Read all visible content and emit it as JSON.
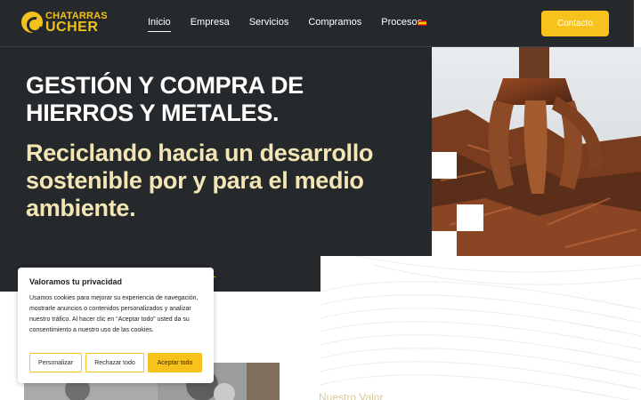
{
  "brand": {
    "line1": "CHATARRAS",
    "line2": "UCHER",
    "color": "#f2c11b"
  },
  "nav": {
    "items": [
      {
        "label": "Inicio",
        "active": true
      },
      {
        "label": "Empresa"
      },
      {
        "label": "Servicios"
      },
      {
        "label": "Compramos"
      },
      {
        "label": "Procesos"
      }
    ],
    "language_flag": "es-flag-icon",
    "contact_label": "Contacto"
  },
  "hero": {
    "title": "GESTIÓN Y COMPRA DE HIERROS Y METALES.",
    "subtitle": "Reciclando hacia un desarrollo sostenible por y para el medio ambiente.",
    "image": "scrap-metal-grapple-image"
  },
  "section": {
    "label": "Nuestro Valor",
    "image": "scrap-metal-pile-image"
  },
  "cookie": {
    "title": "Valoramos tu privacidad",
    "text": "Usamos cookies para mejorar su experiencia de navegación, mostrarle anuncios o contenidos personalizados y analizar nuestro tráfico. Al hacer clic en “Aceptar todo” usted da su consentimiento a nuestro uso de las cookies.",
    "customize_label": "Personalizar",
    "reject_label": "Rechazar todo",
    "accept_label": "Aceptar todo"
  },
  "colors": {
    "dark": "#26292c",
    "accent": "#f7c21b",
    "subtitle": "#f3e6b4"
  }
}
